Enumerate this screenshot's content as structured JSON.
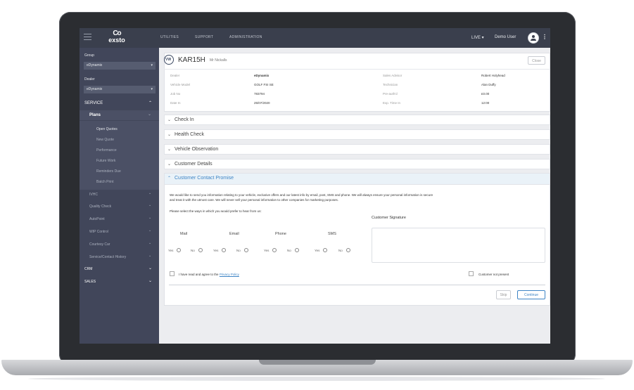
{
  "topbar": {
    "logo": {
      "mark": "Co",
      "text": "exsto"
    },
    "nav": [
      "UTILITIES",
      "SUPPORT",
      "ADMINISTRATION"
    ],
    "live_label": "LIVE ▾",
    "user_label": "Demo User",
    "kebab": "⋮"
  },
  "sidebar": {
    "group_label": "Group",
    "group_value": "eDynamix",
    "dealer_label": "Dealer",
    "dealer_value": "eDynamix",
    "service_label": "SERVICE",
    "plans_label": "Plans",
    "plans_items": [
      "Open Quotes",
      "New Quote",
      "Performance",
      "Future Work",
      "Reminders Due",
      "Batch Print"
    ],
    "service_items": [
      "IVHC",
      "Quality Check",
      "AutoPoint",
      "WIP Control",
      "Courtesy Car",
      "Service/Contact History"
    ],
    "crm_label": "CRM",
    "sales_label": "SALES",
    "caret_up": "⌃",
    "caret_down": "⌄"
  },
  "vehicle": {
    "registration": "KAR15H",
    "customer": "Mr Nickalls",
    "close_label": "Close",
    "details_left": [
      {
        "label": "Dealer",
        "value": "eDynamix"
      },
      {
        "label": "Vehicle Model",
        "value": "GOLF FSI SE"
      },
      {
        "label": "Job No",
        "value": "783794"
      },
      {
        "label": "Date In",
        "value": "25/07/2020"
      }
    ],
    "details_right": [
      {
        "label": "Sales Advisor",
        "value": "Robert Holyhead"
      },
      {
        "label": "Technician",
        "value": "Alan Duffy"
      },
      {
        "label": "Pre-auth'd",
        "value": "£0.00"
      },
      {
        "label": "Exp. Time In",
        "value": "12:00"
      }
    ]
  },
  "sections": [
    {
      "label": "Check In",
      "chevron": "⌄"
    },
    {
      "label": "Health Check",
      "chevron": "⌄"
    },
    {
      "label": "Vehicle Observation",
      "chevron": "⌄"
    },
    {
      "label": "Customer Details",
      "chevron": "⌄"
    },
    {
      "label": "Customer Contact Promise",
      "chevron": "⌃"
    }
  ],
  "promise": {
    "intro_line1": "We would like to send you information relating to your vehicle, exclusive offers and our latest info by email, post, SMS and phone. We will always ensure your personal information is secure",
    "intro_line2": "and treat it with the utmost care. We will never sell your personal information to other companies for marketing purposes.",
    "prompt": "Please select the ways in which you would prefer to hear from us:",
    "channels": [
      "Mail",
      "Email",
      "Phone",
      "SMS"
    ],
    "yes_label": "Yes",
    "no_label": "No",
    "signature_label": "Customer Signature",
    "agree_prefix": "I have read and agree to the",
    "agree_link": "Privacy Policy",
    "not_present_label": "Customer not present",
    "skip_label": "Skip",
    "continue_label": "Continue"
  }
}
